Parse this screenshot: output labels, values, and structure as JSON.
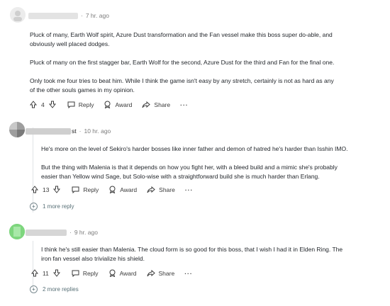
{
  "comments": [
    {
      "time": "7 hr. ago",
      "paragraphs": [
        "Pluck of many, Earth Wolf spirit, Azure Dust transformation and the Fan vessel make this boss super do-able, and",
        "obviously well placed dodges.",
        "Pluck of many on the first stagger bar, Earth Wolf for the second, Azure Dust for the third and Fan for the final one.",
        "Only took me four tries to beat him. While I think the game isn't easy by any stretch, certainly is not as hard as any",
        "of the other souls games in my opinion."
      ],
      "votes": "4",
      "reply": "Reply",
      "award": "Award",
      "share": "Share",
      "more": "···"
    },
    {
      "name_tail": "st",
      "time": "10 hr. ago",
      "paragraphs": [
        "He's more on the level of Sekiro's harder bosses like inner father and demon of hatred he's harder than Isshin IMO.",
        "But the thing with Malenia is that it depends on how you fight her, with a bleed build and a mimic she's probably",
        "easier than Yellow wind Sage, but Solo-wise with a straightforward build she is much harder than Erlang."
      ],
      "votes": "13",
      "reply": "Reply",
      "award": "Award",
      "share": "Share",
      "more": "···",
      "more_replies": "1 more reply"
    },
    {
      "time": "9 hr. ago",
      "paragraphs": [
        "I think he's still easier than Malenia. The cloud form is so good for this boss, that I wish I had it in Elden Ring. The",
        "iron fan vessel also trivialize his shield."
      ],
      "votes": "11",
      "reply": "Reply",
      "award": "Award",
      "share": "Share",
      "more": "···",
      "more_replies": "2 more replies"
    }
  ],
  "colors": {
    "text": "#1f2328",
    "meta": "#7c7c7c",
    "line": "#e0e3e6",
    "avatar3": "#7ed67e"
  }
}
